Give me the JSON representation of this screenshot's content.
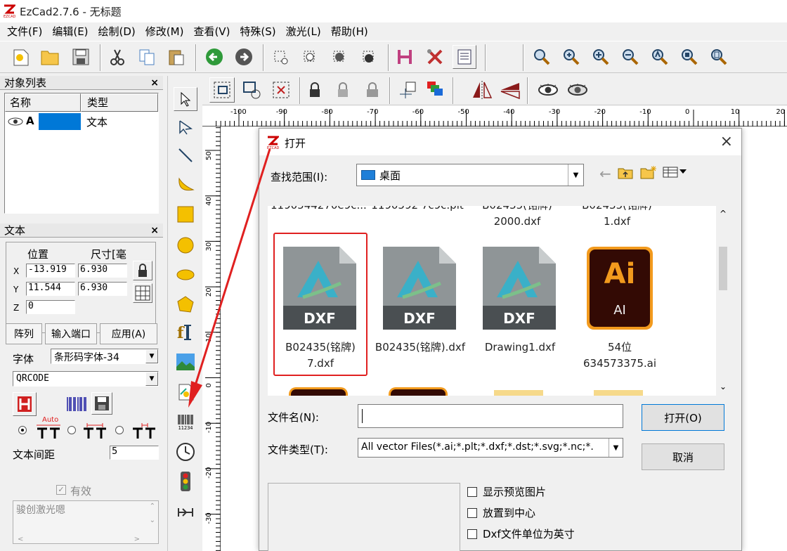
{
  "window": {
    "title": "EzCad2.7.6 - 无标题"
  },
  "menu": [
    "文件(F)",
    "编辑(E)",
    "绘制(D)",
    "修改(M)",
    "查看(V)",
    "特殊(S)",
    "激光(L)",
    "帮助(H)"
  ],
  "object_list": {
    "title": "对象列表",
    "col_name": "名称",
    "col_type": "类型",
    "row": {
      "name": "A",
      "type": "文本"
    }
  },
  "text_panel": {
    "title": "文本",
    "pos_label": "位置",
    "size_label": "尺寸[毫",
    "x_label": "X",
    "y_label": "Y",
    "z_label": "Z",
    "x_pos": "-13.919",
    "y_pos": "11.544",
    "z_pos": "0",
    "x_size": "6.930",
    "y_size": "6.930",
    "array_btn": "阵列",
    "input_port_btn": "输入端口",
    "apply_btn": "应用(A)",
    "font_label": "字体",
    "font_value": "条形码字体-34",
    "barcode_value": "QRCODE",
    "auto_label": "Auto",
    "spacing_label": "文本间距",
    "spacing_value": "5",
    "valid_label": "有效",
    "text_content": "骏创激光嗯"
  },
  "ruler": {
    "h_ticks": [
      "-100",
      "-90",
      "-80",
      "-70",
      "-60",
      "-50",
      "-40",
      "-30",
      "-20",
      "-10",
      "0",
      "10",
      "20"
    ],
    "v_ticks": [
      "50",
      "40",
      "30",
      "20",
      "10",
      "0",
      "-10",
      "-20",
      "-30"
    ]
  },
  "barcode_digits": "11234",
  "dialog": {
    "title": "打开",
    "look_in_label": "查找范围(I):",
    "look_in_value": "桌面",
    "partial_top": [
      "1190544270e9c...",
      "1190592 7c9c.plt",
      "B02435(铭牌)",
      "B02435(铭牌)"
    ],
    "top_row": [
      "",
      "",
      "B02435(铭牌)\n2000.dxf",
      "B02435(铭牌)\n1.dxf"
    ],
    "files": [
      {
        "icon_text": "DXF",
        "name": "B02435(铭牌)\n7.dxf",
        "selected": true
      },
      {
        "icon_text": "DXF",
        "name": "B02435(铭牌).dxf",
        "selected": false
      },
      {
        "icon_text": "DXF",
        "name": "Drawing1.dxf",
        "selected": false
      },
      {
        "icon_text": "AI",
        "name": "54位\n634573375.ai",
        "selected": false
      }
    ],
    "ai_logo": "Ai",
    "filename_label": "文件名(N):",
    "filename_value": "",
    "filetype_label": "文件类型(T):",
    "filetype_value": "All vector Files(*.ai;*.plt;*.dxf;*.dst;*.svg;*.nc;*.",
    "open_btn": "打开(O)",
    "cancel_btn": "取消",
    "opt_preview": "显示预览图片",
    "opt_center": "放置到中心",
    "opt_inch": "Dxf文件单位为英寸"
  },
  "colors": {
    "accent_red": "#e02020",
    "select_blue": "#0078d7"
  }
}
